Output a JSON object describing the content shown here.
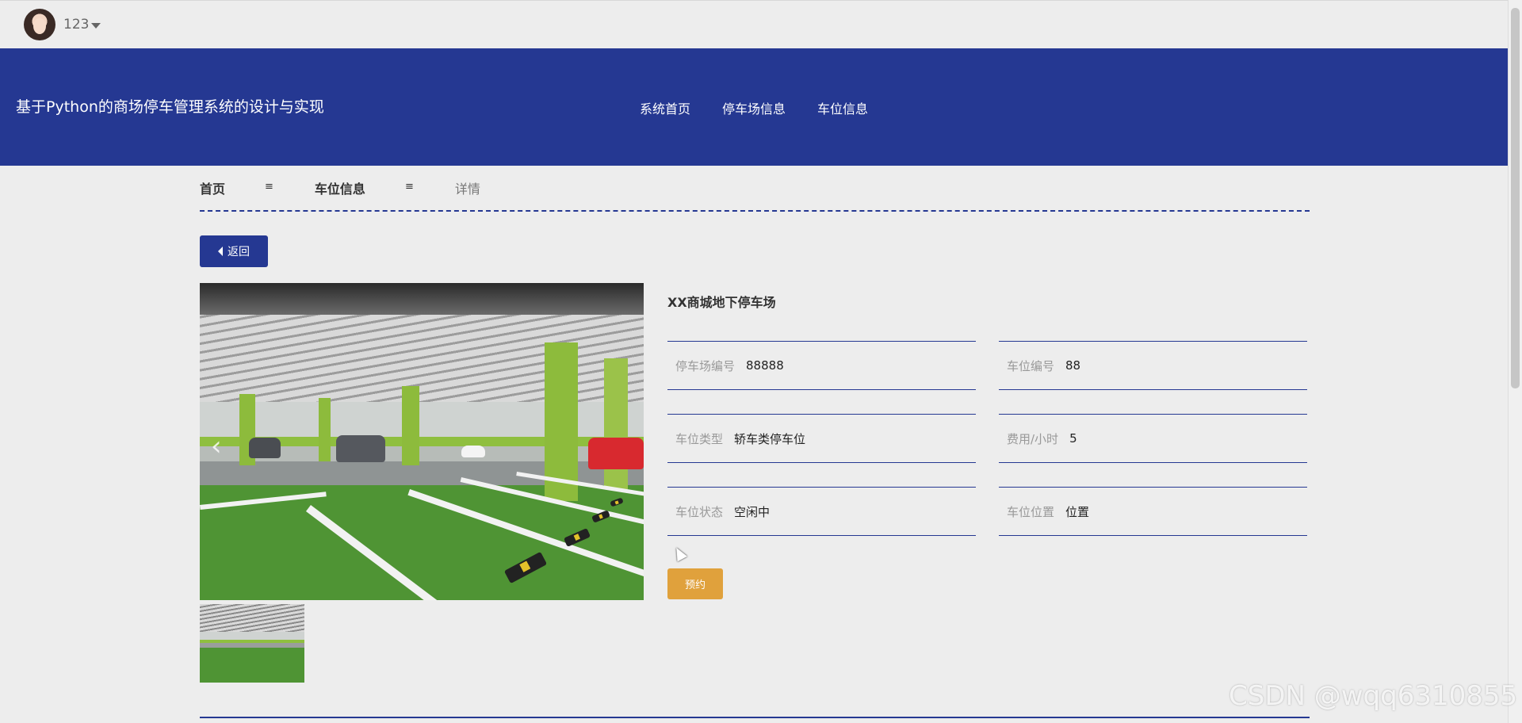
{
  "user": {
    "name": "123"
  },
  "header": {
    "title": "基于Python的商场停车管理系统的设计与实现",
    "nav": [
      "系统首页",
      "停车场信息",
      "车位信息"
    ]
  },
  "breadcrumb": {
    "home": "首页",
    "section": "车位信息",
    "current": "详情",
    "separator": "≡"
  },
  "back_button": {
    "label": "返回"
  },
  "detail": {
    "title": "XX商城地下停车场",
    "fields": [
      {
        "label": "停车场编号",
        "value": "88888"
      },
      {
        "label": "车位编号",
        "value": "88"
      },
      {
        "label": "车位类型",
        "value": "轿车类停车位"
      },
      {
        "label": "费用/小时",
        "value": "5"
      },
      {
        "label": "车位状态",
        "value": "空闲中"
      },
      {
        "label": "车位位置",
        "value": "位置"
      }
    ],
    "reserve_label": "预约"
  },
  "watermark": "CSDN @wqq6310855",
  "colors": {
    "primary": "#253892",
    "accent": "#e0a13c"
  }
}
